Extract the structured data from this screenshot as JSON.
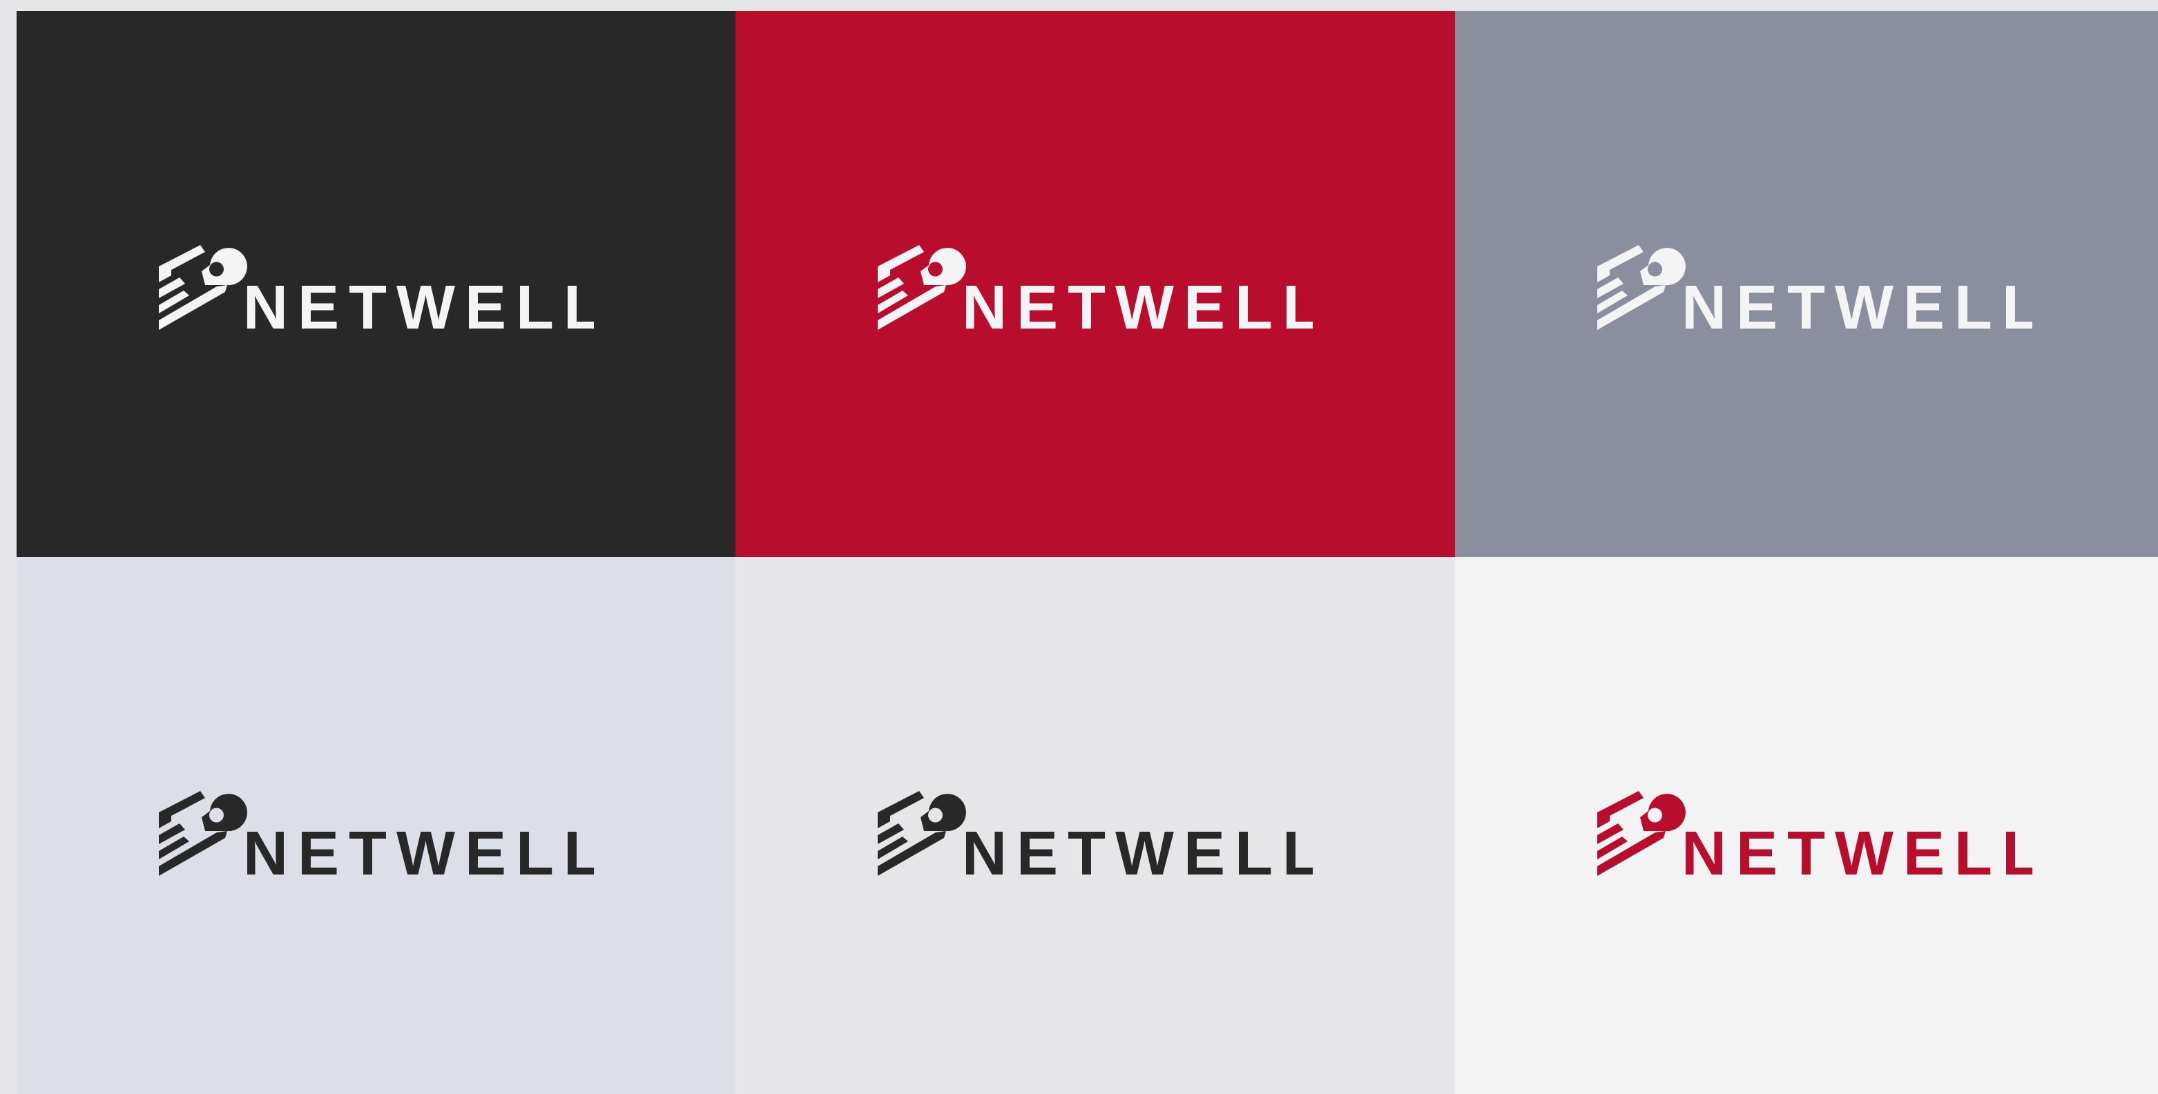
{
  "brand": {
    "wordmark": "NETWELL"
  },
  "palette": {
    "page_background": "#e6e6e8",
    "dark": "#282828",
    "red": "#b90d2e",
    "gray": "#8b8e9c",
    "light_blue_gray": "#dcdfe7",
    "light_gray": "#e6e6e8",
    "off_white": "#f3f3f3",
    "white_logo": "#f4f4f4"
  },
  "tiles": [
    {
      "name": "tile-dark",
      "background": "#282828",
      "logo_color": "#f4f4f4"
    },
    {
      "name": "tile-red",
      "background": "#b90d2e",
      "logo_color": "#f4f4f4"
    },
    {
      "name": "tile-gray",
      "background": "#8b8e9c",
      "logo_color": "#f4f4f4"
    },
    {
      "name": "tile-light-blue-gray",
      "background": "#dcdfe7",
      "logo_color": "#282828"
    },
    {
      "name": "tile-light-gray",
      "background": "#e6e6e8",
      "logo_color": "#282828"
    },
    {
      "name": "tile-off-white",
      "background": "#f3f3f3",
      "logo_color": "#b90d2e"
    }
  ],
  "icons": {
    "logo_mark": "netwell-mark-icon"
  }
}
